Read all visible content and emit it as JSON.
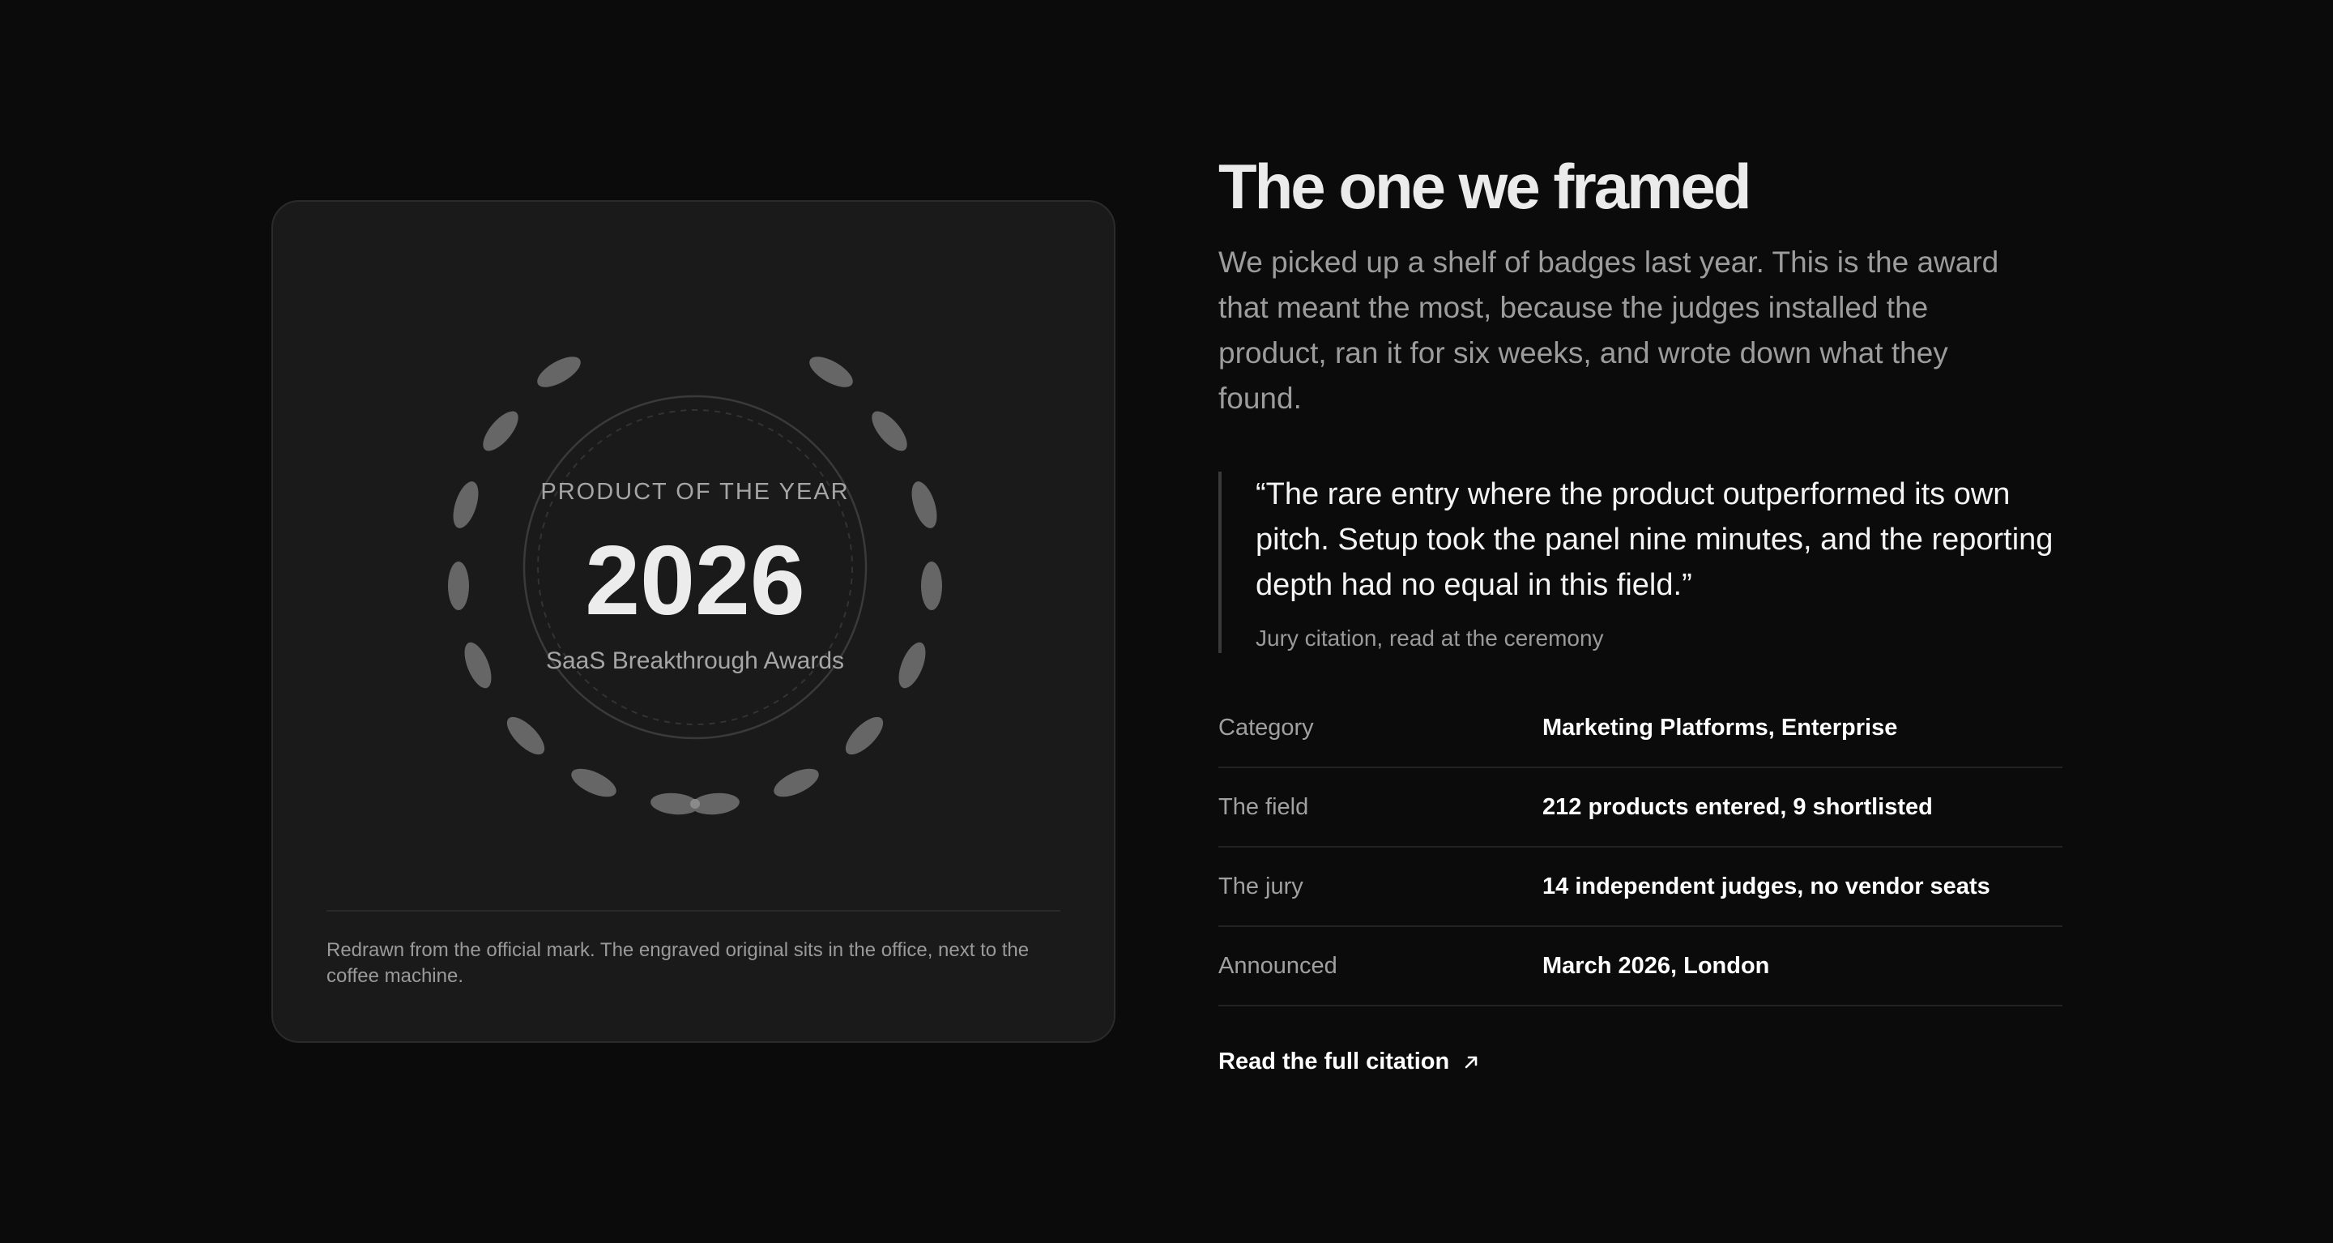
{
  "badge": {
    "title": "PRODUCT OF THE YEAR",
    "year": "2026",
    "subtitle": "SaaS Breakthrough Awards"
  },
  "card": {
    "note": "Redrawn from the official mark. The engraved original sits in the office, next to the coffee machine."
  },
  "section": {
    "heading": "The one we framed",
    "intro": "We picked up a shelf of badges last year. This is the award that meant the most, because the judges installed the product, ran it for six weeks, and wrote down what they found."
  },
  "quote": {
    "text": "“The rare entry where the product outperformed its own pitch. Setup took the panel nine minutes, and the reporting depth had no equal in this field.”",
    "source": "Jury citation, read at the ceremony"
  },
  "facts": [
    {
      "label": "Category",
      "value": "Marketing Platforms, Enterprise"
    },
    {
      "label": "The field",
      "value": "212 products entered, 9 shortlisted"
    },
    {
      "label": "The jury",
      "value": "14 independent judges, no vendor seats"
    },
    {
      "label": "Announced",
      "value": "March 2026, London"
    }
  ],
  "cta": {
    "label": "Read the full citation",
    "icon": "arrow-up-right-icon"
  },
  "colors": {
    "background": "#0b0b0b",
    "card": "#1a1a1a",
    "laurel": "#6a6a6a",
    "muted_text": "#9c9c9c",
    "heading_text": "#ebebeb"
  }
}
